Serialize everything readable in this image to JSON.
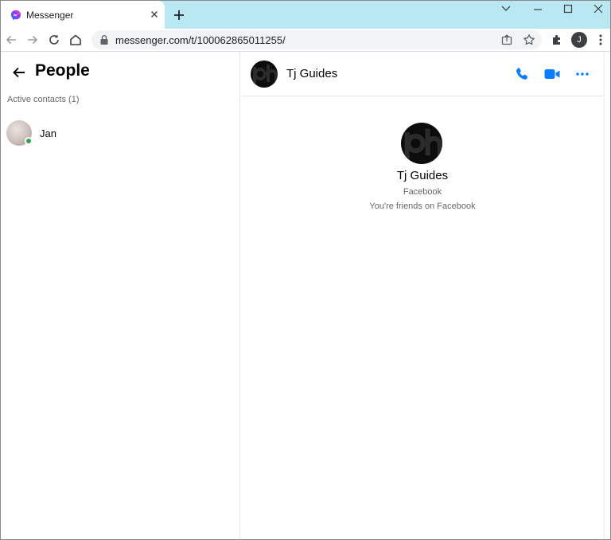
{
  "browser": {
    "tab_title": "Messenger",
    "url": "messenger.com/t/100062865011255/",
    "profile_initial": "J"
  },
  "sidebar": {
    "title": "People",
    "active_contacts_label": "Active contacts (1)",
    "contacts": [
      {
        "name": "Jan",
        "online": true
      }
    ]
  },
  "chat": {
    "header_name": "Tj Guides",
    "profile_name": "Tj Guides",
    "profile_subtitle": "Facebook",
    "friend_status": "You're friends on Facebook"
  },
  "colors": {
    "accent": "#0a7cff",
    "tabstrip": "#b9e7f2",
    "online": "#31a24c"
  },
  "icons": {
    "favicon": "messenger-icon",
    "back": "arrow-left-icon",
    "call": "phone-icon",
    "video": "video-camera-icon",
    "more": "more-horizontal-icon"
  }
}
